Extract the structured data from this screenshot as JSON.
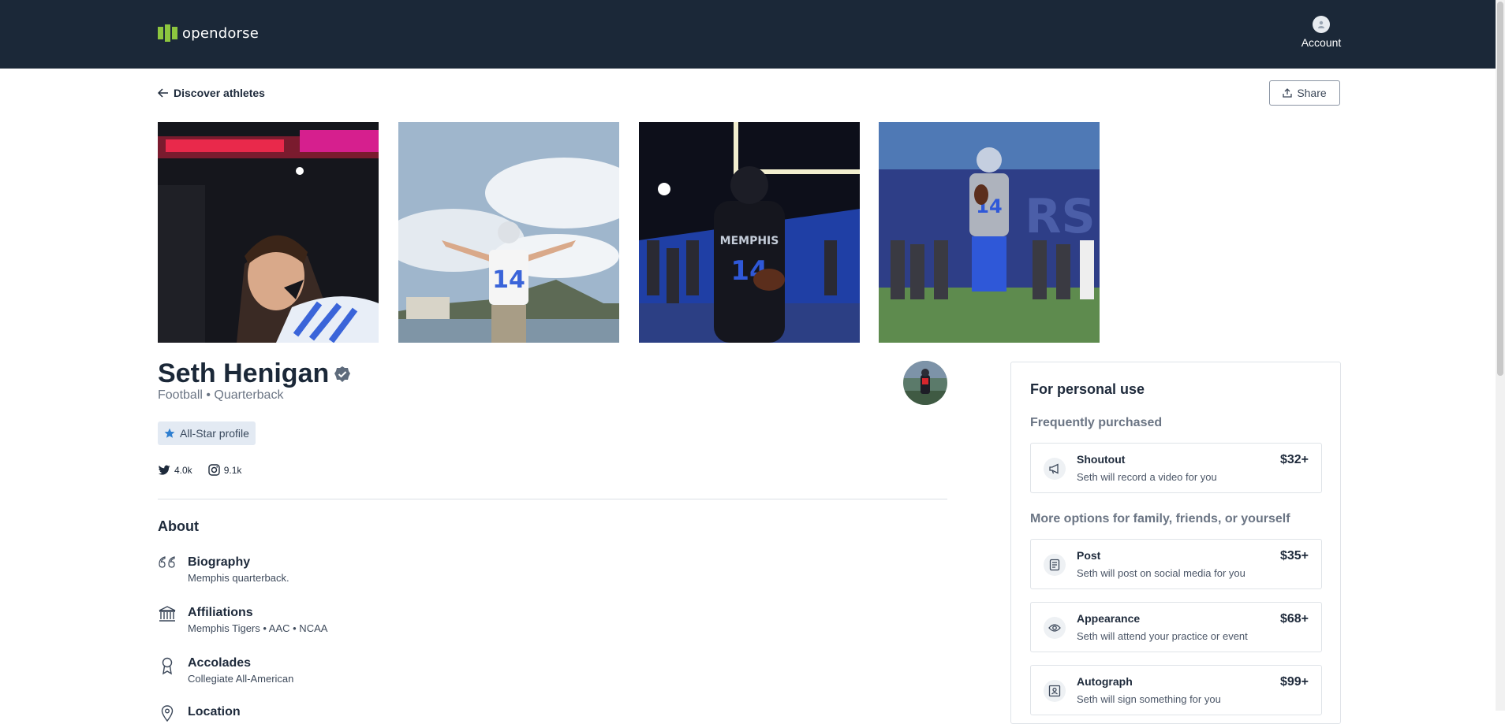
{
  "brand": {
    "name": "opendorse"
  },
  "header": {
    "account_label": "Account"
  },
  "nav": {
    "back_label": "Discover athletes",
    "share_label": "Share"
  },
  "athlete": {
    "name": "Seth Henigan",
    "subtitle": "Football • Quarterback",
    "badge": "All-Star profile",
    "socials": [
      {
        "platform": "twitter",
        "icon": "twitter-icon",
        "count": "4.0k"
      },
      {
        "platform": "instagram",
        "icon": "instagram-icon",
        "count": "9.1k"
      }
    ]
  },
  "about": {
    "title": "About",
    "items": [
      {
        "icon": "quote-icon",
        "label": "Biography",
        "value": "Memphis quarterback."
      },
      {
        "icon": "institution-icon",
        "label": "Affiliations",
        "value": "Memphis Tigers • AAC • NCAA"
      },
      {
        "icon": "medal-icon",
        "label": "Accolades",
        "value": "Collegiate All-American"
      },
      {
        "icon": "location-icon",
        "label": "Location",
        "value": ""
      }
    ]
  },
  "panel": {
    "title": "For personal use",
    "frequent_heading": "Frequently purchased",
    "more_heading": "More options for family, friends, or yourself",
    "frequent": [
      {
        "icon": "megaphone-icon",
        "name": "Shoutout",
        "desc": "Seth will record a video for you",
        "price": "$32+"
      }
    ],
    "more": [
      {
        "icon": "post-icon",
        "name": "Post",
        "desc": "Seth will post on social media for you",
        "price": "$35+"
      },
      {
        "icon": "eye-icon",
        "name": "Appearance",
        "desc": "Seth will attend your practice or event",
        "price": "$68+"
      },
      {
        "icon": "autograph-icon",
        "name": "Autograph",
        "desc": "Seth will sign something for you",
        "price": "$99+"
      }
    ]
  },
  "colors": {
    "header_bg": "#1b2838",
    "accent": "#2f7fd0",
    "badge_bg": "#e3eaf3",
    "logo_green": "#8dc63f"
  }
}
